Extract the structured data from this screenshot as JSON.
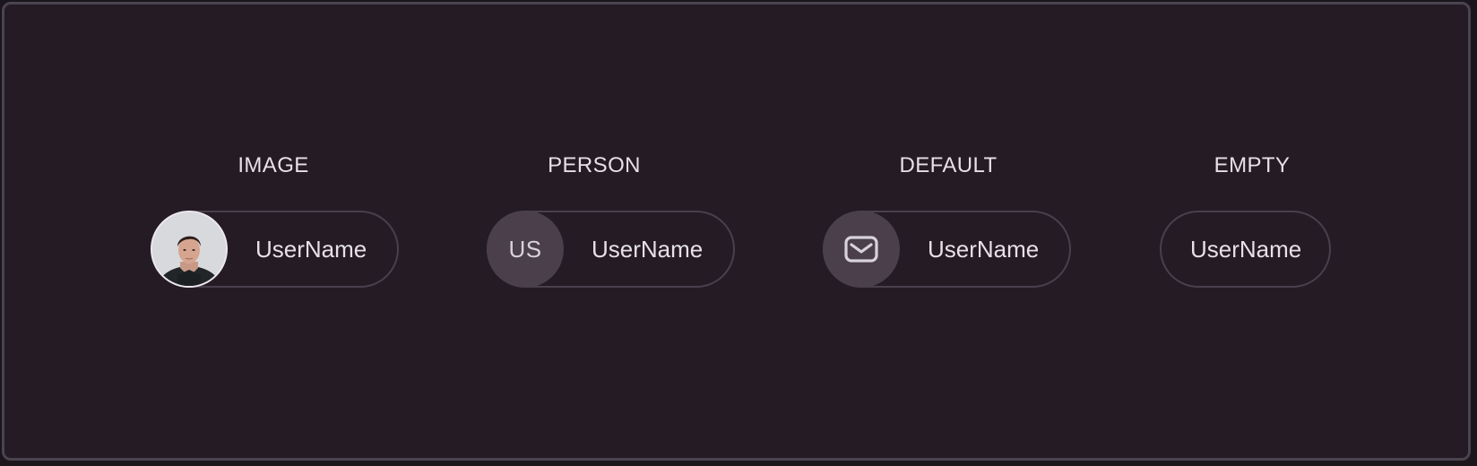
{
  "variants": {
    "image": {
      "title": "IMAGE",
      "label": "UserName",
      "avatar_kind": "photo",
      "avatar_alt": "profile photo"
    },
    "person": {
      "title": "PERSON",
      "label": "UserName",
      "initials": "US"
    },
    "default": {
      "title": "DEFAULT",
      "label": "UserName",
      "icon": "mail-icon"
    },
    "empty": {
      "title": "EMPTY",
      "label": "UserName"
    }
  },
  "colors": {
    "background": "#241b24",
    "frame_border": "#4a4450",
    "chip_border": "#4a3f4c",
    "avatar_fill": "#4a3f4b",
    "text": "#e6e0e8"
  }
}
